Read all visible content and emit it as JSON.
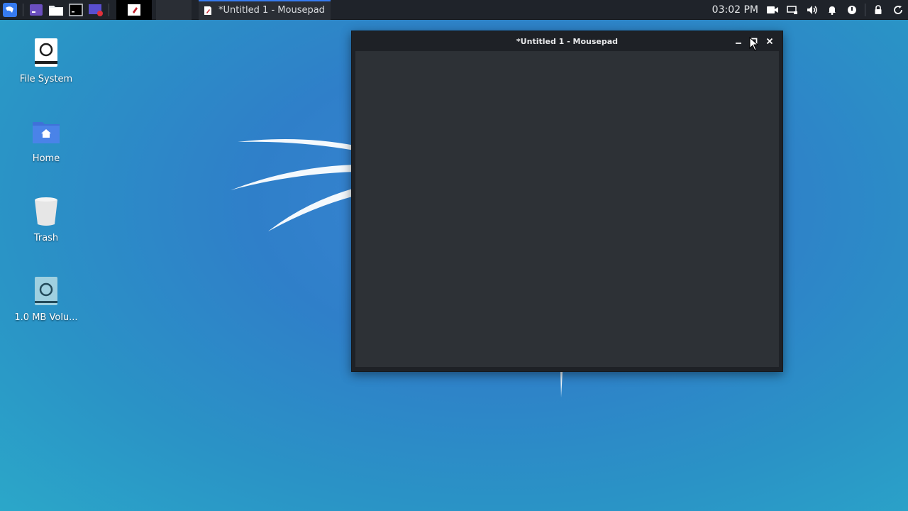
{
  "panel": {
    "task_title": "*Untitled 1 - Mousepad",
    "clock": "03:02 PM",
    "icons": [
      "kali-menu-icon",
      "terminal-launcher-icon",
      "file-manager-icon",
      "terminal-icon",
      "screen-recorder-icon",
      "video-icon",
      "display-icon",
      "volume-icon",
      "bell-icon",
      "power-icon",
      "lock-icon",
      "refresh-icon"
    ]
  },
  "desktop": {
    "icons": [
      {
        "label": "File System"
      },
      {
        "label": "Home"
      },
      {
        "label": "Trash"
      },
      {
        "label": "1.0 MB Volu..."
      }
    ]
  },
  "window": {
    "title": "*Untitled 1 - Mousepad",
    "editor_text": ""
  },
  "colors": {
    "accent": "#367bf0",
    "panel": "#1f232a",
    "editor_bg": "#2d3136"
  }
}
